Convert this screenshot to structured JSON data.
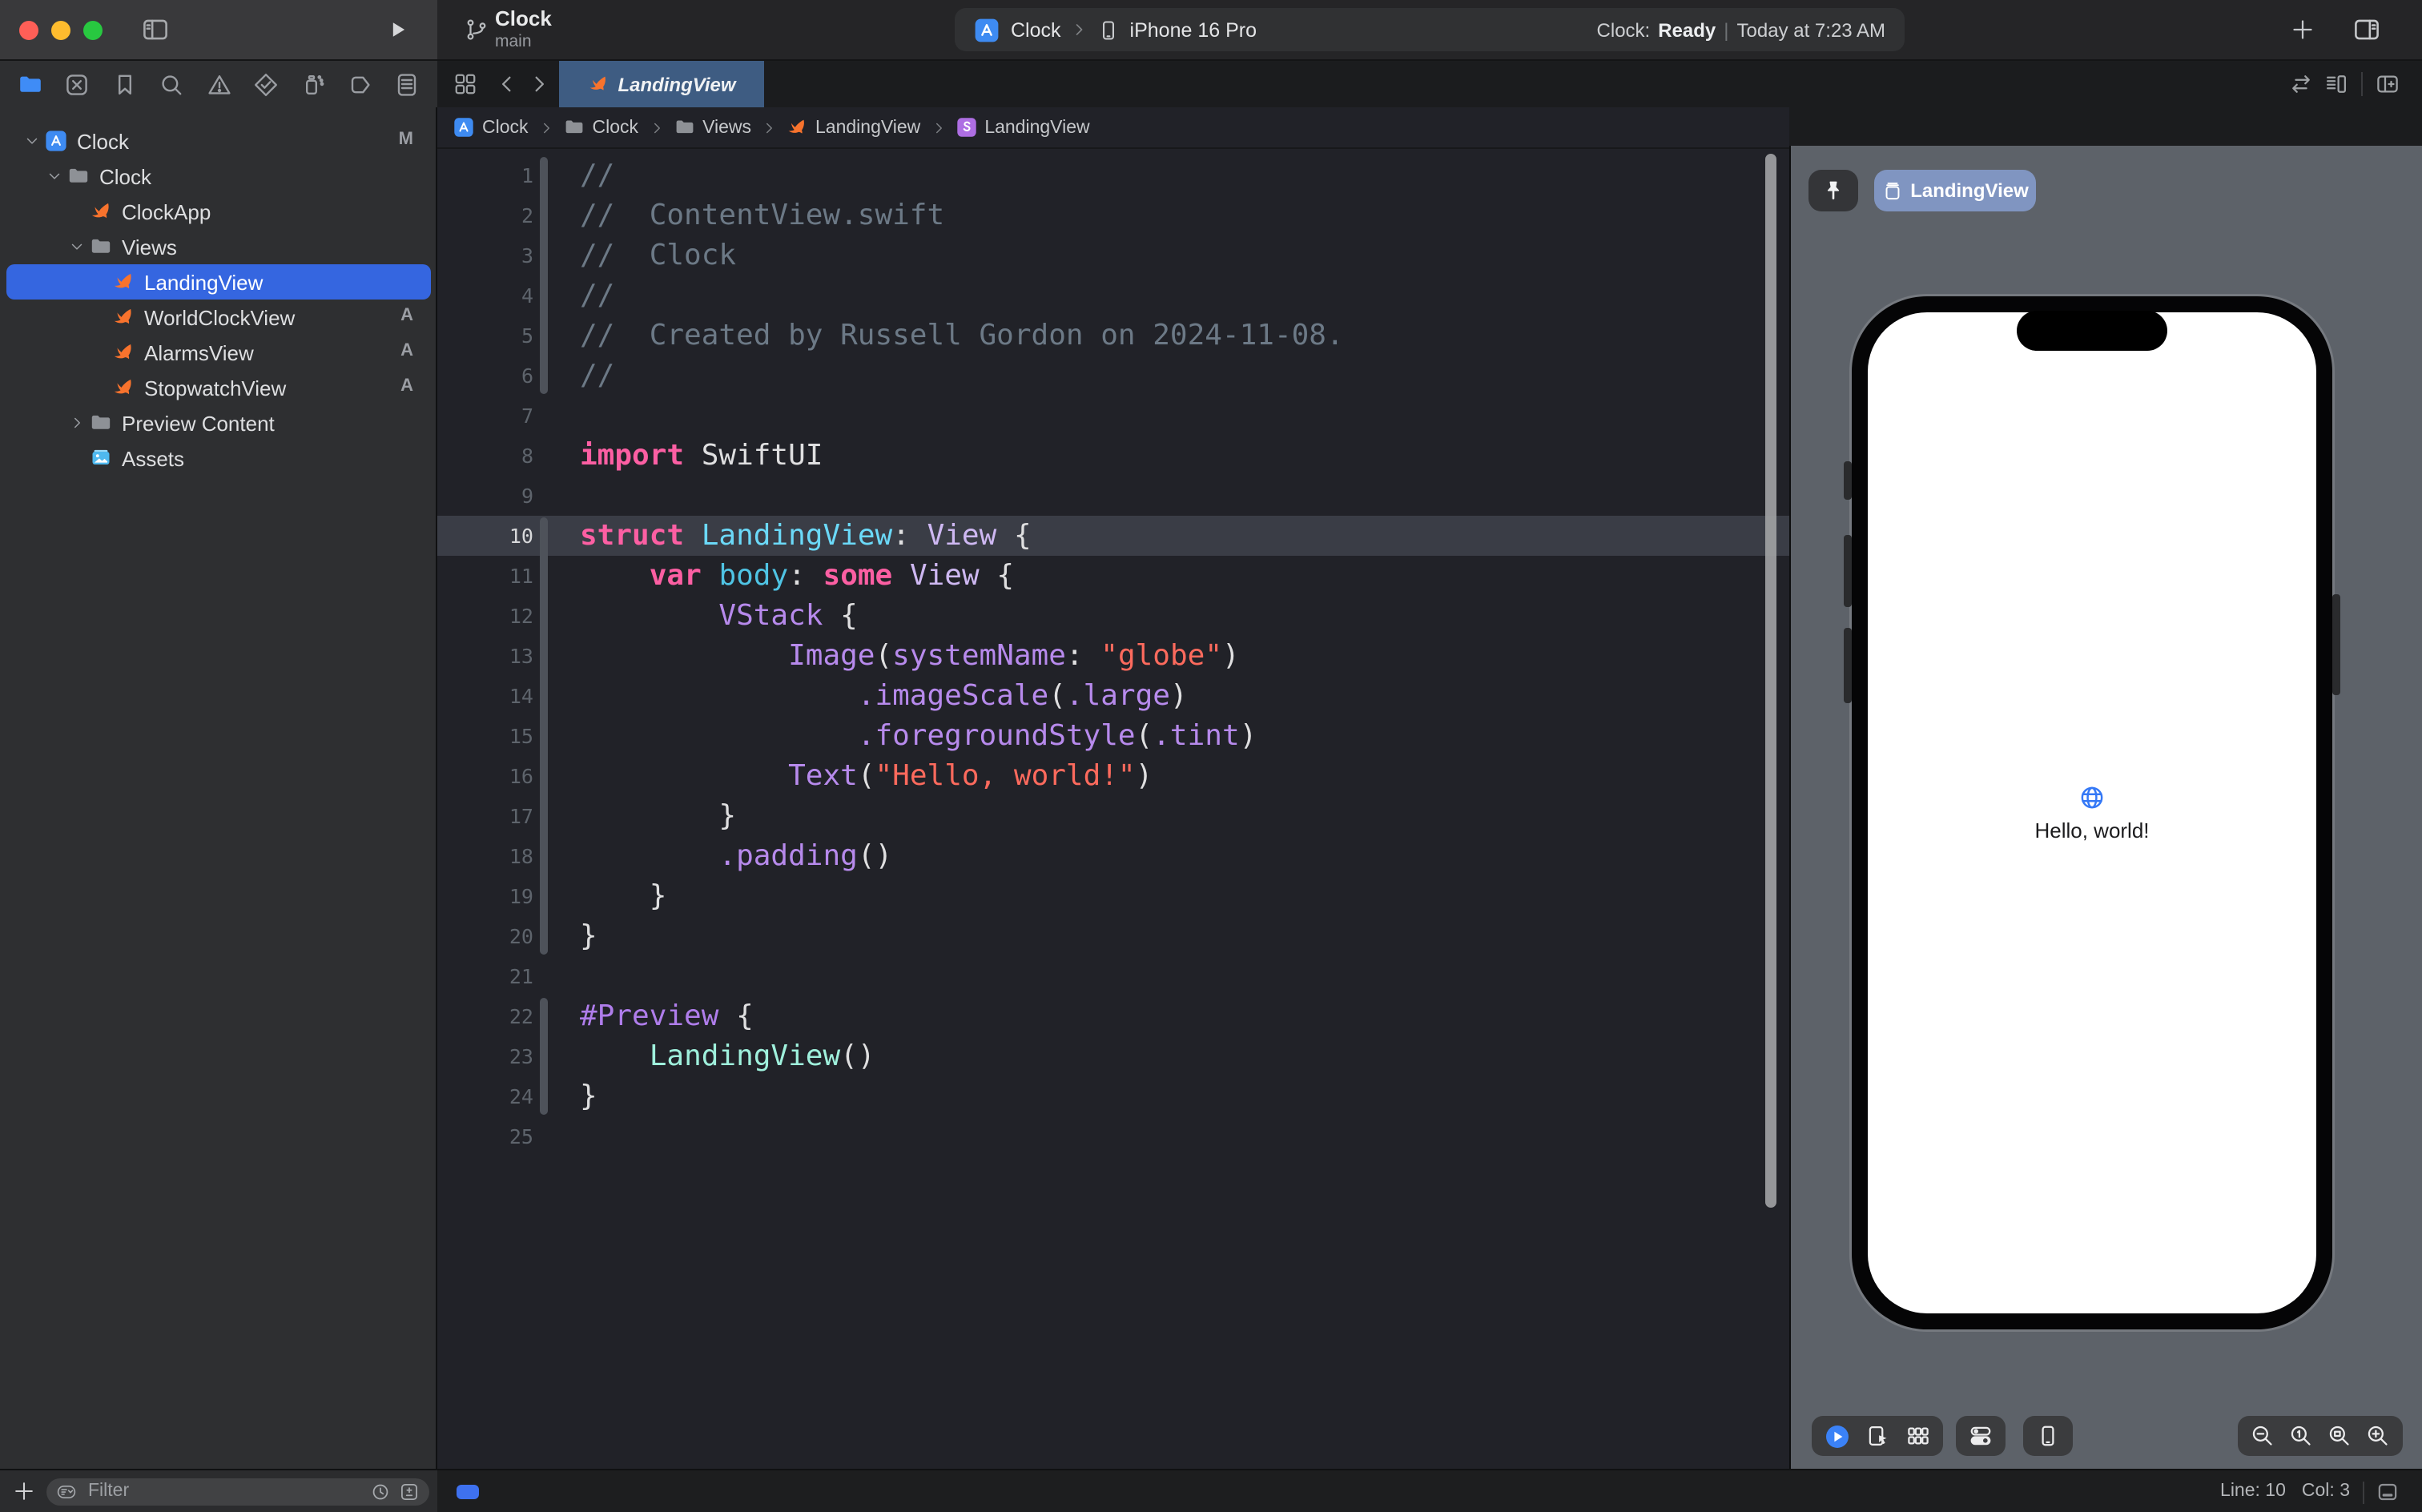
{
  "window": {
    "traffic": [
      "close",
      "minimize",
      "zoom"
    ],
    "project": "Clock",
    "branch": "main",
    "scheme": {
      "target": "Clock",
      "device": "iPhone 16 Pro"
    },
    "status": {
      "prefix": "Clock:",
      "state": "Ready",
      "divider": "|",
      "time": "Today at 7:23 AM"
    }
  },
  "navigator": {
    "items": [
      {
        "name": "project",
        "icon": "folder-filled",
        "active": true
      },
      {
        "name": "source-control",
        "icon": "xbox",
        "active": false
      },
      {
        "name": "bookmarks",
        "icon": "bookmark",
        "active": false
      },
      {
        "name": "find",
        "icon": "search",
        "active": false
      },
      {
        "name": "issues",
        "icon": "warning",
        "active": false
      },
      {
        "name": "tests",
        "icon": "tests",
        "active": false
      },
      {
        "name": "debug",
        "icon": "debug",
        "active": false
      },
      {
        "name": "breakpoints",
        "icon": "breakpoints",
        "active": false
      },
      {
        "name": "reports",
        "icon": "reports",
        "active": false
      }
    ]
  },
  "tabs": [
    {
      "label": "LandingView",
      "icon": "swift",
      "active": true
    }
  ],
  "jumpbar": {
    "items": [
      {
        "icon": "app-chip",
        "label": "Clock"
      },
      {
        "icon": "folder",
        "label": "Clock"
      },
      {
        "icon": "folder",
        "label": "Views"
      },
      {
        "icon": "swift",
        "label": "LandingView"
      },
      {
        "icon": "s-chip",
        "label": "LandingView"
      }
    ]
  },
  "sidebar": {
    "items": [
      {
        "label": "Clock",
        "icon": "app-chip",
        "level": 0,
        "chevron": "open",
        "badge": "M",
        "selected": false
      },
      {
        "label": "Clock",
        "icon": "folder",
        "level": 1,
        "chevron": "open",
        "badge": "",
        "selected": false
      },
      {
        "label": "ClockApp",
        "icon": "swift",
        "level": 2,
        "chevron": "",
        "badge": "",
        "selected": false
      },
      {
        "label": "Views",
        "icon": "folder",
        "level": 2,
        "chevron": "open",
        "badge": "",
        "selected": false
      },
      {
        "label": "LandingView",
        "icon": "swift",
        "level": 3,
        "chevron": "",
        "badge": "",
        "selected": true
      },
      {
        "label": "WorldClockView",
        "icon": "swift",
        "level": 3,
        "chevron": "",
        "badge": "A",
        "selected": false
      },
      {
        "label": "AlarmsView",
        "icon": "swift",
        "level": 3,
        "chevron": "",
        "badge": "A",
        "selected": false
      },
      {
        "label": "StopwatchView",
        "icon": "swift",
        "level": 3,
        "chevron": "",
        "badge": "A",
        "selected": false
      },
      {
        "label": "Preview Content",
        "icon": "folder",
        "level": 2,
        "chevron": "closed",
        "badge": "",
        "selected": false
      },
      {
        "label": "Assets",
        "icon": "assets",
        "level": 2,
        "chevron": "",
        "badge": "",
        "selected": false
      }
    ]
  },
  "editor": {
    "current_line": 10,
    "change_ranges": [
      [
        1,
        6
      ],
      [
        10,
        20
      ],
      [
        22,
        24
      ]
    ],
    "lines": [
      {
        "num": 1,
        "tokens": [
          [
            "c",
            "//"
          ]
        ]
      },
      {
        "num": 2,
        "tokens": [
          [
            "c",
            "//  ContentView.swift"
          ]
        ]
      },
      {
        "num": 3,
        "tokens": [
          [
            "c",
            "//  Clock"
          ]
        ]
      },
      {
        "num": 4,
        "tokens": [
          [
            "c",
            "//"
          ]
        ]
      },
      {
        "num": 5,
        "tokens": [
          [
            "c",
            "//  Created by Russell Gordon on 2024-11-08."
          ]
        ]
      },
      {
        "num": 6,
        "tokens": [
          [
            "c",
            "//"
          ]
        ]
      },
      {
        "num": 7,
        "tokens": []
      },
      {
        "num": 8,
        "tokens": [
          [
            "k",
            "import"
          ],
          [
            "p",
            " SwiftUI"
          ]
        ]
      },
      {
        "num": 9,
        "tokens": []
      },
      {
        "num": 10,
        "tokens": [
          [
            "k",
            "struct"
          ],
          [
            "p",
            " "
          ],
          [
            "td",
            "LandingView"
          ],
          [
            "p",
            ": "
          ],
          [
            "ty",
            "View"
          ],
          [
            "p",
            " {"
          ]
        ]
      },
      {
        "num": 11,
        "tokens": [
          [
            "p",
            "    "
          ],
          [
            "k",
            "var"
          ],
          [
            "p",
            " "
          ],
          [
            "pd",
            "body"
          ],
          [
            "p",
            ": "
          ],
          [
            "k",
            "some"
          ],
          [
            "p",
            " "
          ],
          [
            "ty",
            "View"
          ],
          [
            "p",
            " {"
          ]
        ]
      },
      {
        "num": 12,
        "tokens": [
          [
            "p",
            "        "
          ],
          [
            "m",
            "VStack"
          ],
          [
            "p",
            " {"
          ]
        ]
      },
      {
        "num": 13,
        "tokens": [
          [
            "p",
            "            "
          ],
          [
            "m",
            "Image"
          ],
          [
            "p",
            "("
          ],
          [
            "m",
            "systemName"
          ],
          [
            "p",
            ": "
          ],
          [
            "s",
            "\"globe\""
          ],
          [
            "p",
            ")"
          ]
        ]
      },
      {
        "num": 14,
        "tokens": [
          [
            "p",
            "                "
          ],
          [
            "m",
            ".imageScale"
          ],
          [
            "p",
            "("
          ],
          [
            "m",
            ".large"
          ],
          [
            "p",
            ")"
          ]
        ]
      },
      {
        "num": 15,
        "tokens": [
          [
            "p",
            "                "
          ],
          [
            "m",
            ".foregroundStyle"
          ],
          [
            "p",
            "("
          ],
          [
            "m",
            ".tint"
          ],
          [
            "p",
            ")"
          ]
        ]
      },
      {
        "num": 16,
        "tokens": [
          [
            "p",
            "            "
          ],
          [
            "m",
            "Text"
          ],
          [
            "p",
            "("
          ],
          [
            "s",
            "\"Hello, world!\""
          ],
          [
            "p",
            ")"
          ]
        ]
      },
      {
        "num": 17,
        "tokens": [
          [
            "p",
            "        }"
          ]
        ]
      },
      {
        "num": 18,
        "tokens": [
          [
            "p",
            "        "
          ],
          [
            "m",
            ".padding"
          ],
          [
            "p",
            "()"
          ]
        ]
      },
      {
        "num": 19,
        "tokens": [
          [
            "p",
            "    }"
          ]
        ]
      },
      {
        "num": 20,
        "tokens": [
          [
            "p",
            "}"
          ]
        ]
      },
      {
        "num": 21,
        "tokens": []
      },
      {
        "num": 22,
        "tokens": [
          [
            "mc",
            "#Preview"
          ],
          [
            "p",
            " {"
          ]
        ]
      },
      {
        "num": 23,
        "tokens": [
          [
            "p",
            "    "
          ],
          [
            "pt",
            "LandingView"
          ],
          [
            "p",
            "()"
          ]
        ]
      },
      {
        "num": 24,
        "tokens": [
          [
            "p",
            "}"
          ]
        ]
      },
      {
        "num": 25,
        "tokens": []
      }
    ]
  },
  "canvas": {
    "chip_label": "LandingView",
    "preview_text": "Hello, world!"
  },
  "preview_toolbar": {
    "left": [
      "preview-play",
      "pointer-device",
      "variants-grid"
    ],
    "device_settings": [
      "toggles"
    ],
    "device": [
      "phone-outline"
    ],
    "zoom": [
      "zoom-out",
      "zoom-actual",
      "zoom-fit",
      "zoom-in"
    ]
  },
  "bottombar": {
    "filter_placeholder": "Filter",
    "line": "Line: 10",
    "col": "Col: 3"
  },
  "colors": {
    "selection_blue": "#3566e0",
    "tab_active": "#3e5c82",
    "canvas_background": "#5d6269",
    "accent_pill": "#3e71ef",
    "swift_orange": "#f8732d",
    "globe_blue": "#3478f6",
    "keyword": "#fc5fa3",
    "string": "#fc6a5d",
    "member": "#b78aec",
    "type": "#ceb8f2",
    "type_declaration": "#6bd9f8",
    "comment": "#6c7986",
    "project_type": "#9ff0dc"
  }
}
